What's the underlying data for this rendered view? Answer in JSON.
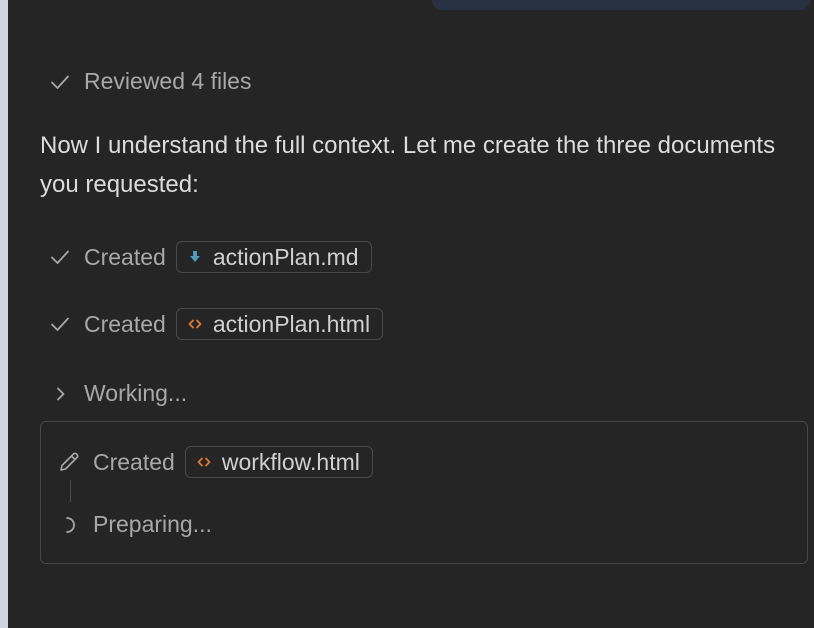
{
  "steps": {
    "reviewed": {
      "icon": "checkmark-icon",
      "text": "Reviewed 4 files"
    },
    "created_1": {
      "icon": "checkmark-icon",
      "prefix": "Created",
      "file": "actionPlan.md",
      "file_icon": "markdown-download-icon"
    },
    "created_2": {
      "icon": "checkmark-icon",
      "prefix": "Created",
      "file": "actionPlan.html",
      "file_icon": "html-code-icon"
    },
    "working": {
      "icon": "chevron-right-icon",
      "text": "Working..."
    }
  },
  "message": "Now I understand the full context. Let me create the three documents you requested:",
  "panel": {
    "created": {
      "icon": "pencil-icon",
      "prefix": "Created",
      "file": "workflow.html",
      "file_icon": "html-code-icon"
    },
    "preparing": {
      "icon": "spinner-icon",
      "text": "Preparing..."
    }
  },
  "colors": {
    "background": "#252526",
    "html_icon": "#e37933",
    "markdown_icon": "#519aba",
    "muted_text": "#a8a8a8"
  }
}
